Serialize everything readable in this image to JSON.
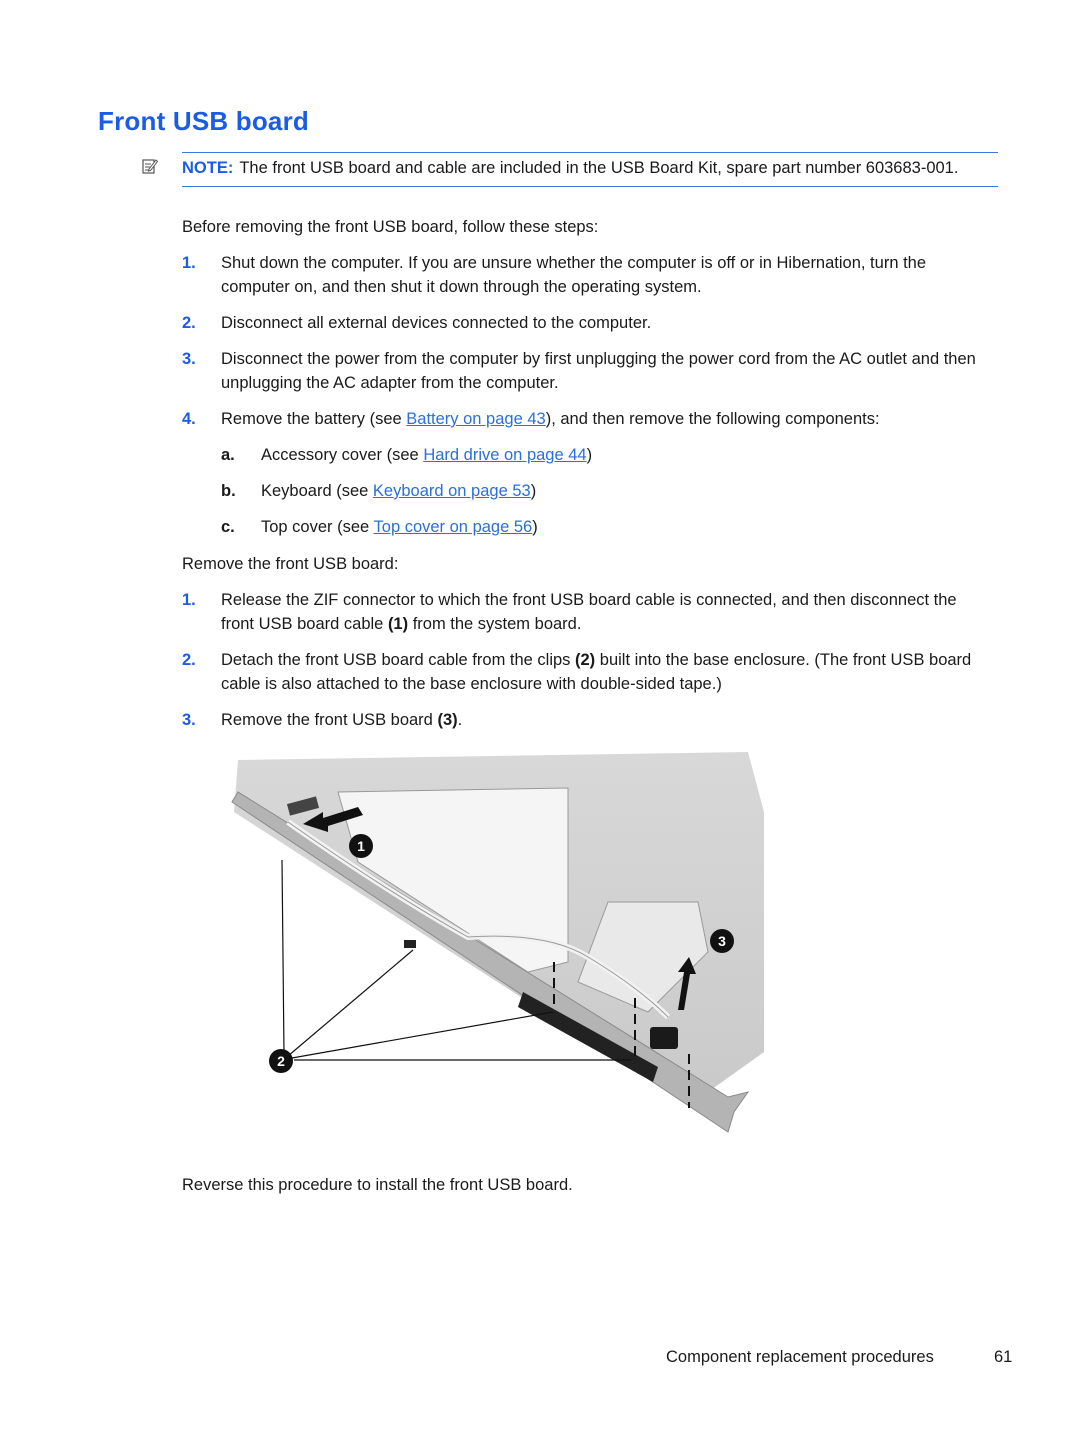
{
  "title": "Front USB board",
  "note": {
    "label": "NOTE:",
    "text": "The front USB board and cable are included in the USB Board Kit, spare part number 603683-001."
  },
  "before_intro": "Before removing the front USB board, follow these steps:",
  "before_steps": [
    {
      "num": "1.",
      "text": "Shut down the computer. If you are unsure whether the computer is off or in Hibernation, turn the computer on, and then shut it down through the operating system."
    },
    {
      "num": "2.",
      "text": "Disconnect all external devices connected to the computer."
    },
    {
      "num": "3.",
      "text": "Disconnect the power from the computer by first unplugging the power cord from the AC outlet and then unplugging the AC adapter from the computer."
    },
    {
      "num": "4.",
      "pre": "Remove the battery (see ",
      "link": "Battery on page 43",
      "post": "), and then remove the following components:"
    }
  ],
  "sub_steps": [
    {
      "num": "a.",
      "pre": "Accessory cover (see ",
      "link": "Hard drive on page 44",
      "post": ")"
    },
    {
      "num": "b.",
      "pre": "Keyboard (see ",
      "link": "Keyboard on page 53",
      "post": ")"
    },
    {
      "num": "c.",
      "pre": "Top cover (see ",
      "link": "Top cover on page 56",
      "post": ")"
    }
  ],
  "remove_intro": "Remove the front USB board:",
  "remove_steps": [
    {
      "num": "1.",
      "pre": "Release the ZIF connector to which the front USB board cable is connected, and then disconnect the front USB board cable ",
      "ref": "(1)",
      "post": " from the system board."
    },
    {
      "num": "2.",
      "pre": "Detach the front USB board cable from the clips ",
      "ref": "(2)",
      "post": " built into the base enclosure. (The front USB board cable is also attached to the base enclosure with double-sided tape.)"
    },
    {
      "num": "3.",
      "pre": "Remove the front USB board ",
      "ref": "(3)",
      "post": "."
    }
  ],
  "figure": {
    "callouts": [
      "1",
      "2",
      "3"
    ],
    "description": "Base enclosure showing front USB board cable, clips and board removal"
  },
  "closing": "Reverse this procedure to install the front USB board.",
  "footer": {
    "section": "Component replacement procedures",
    "page": "61"
  }
}
